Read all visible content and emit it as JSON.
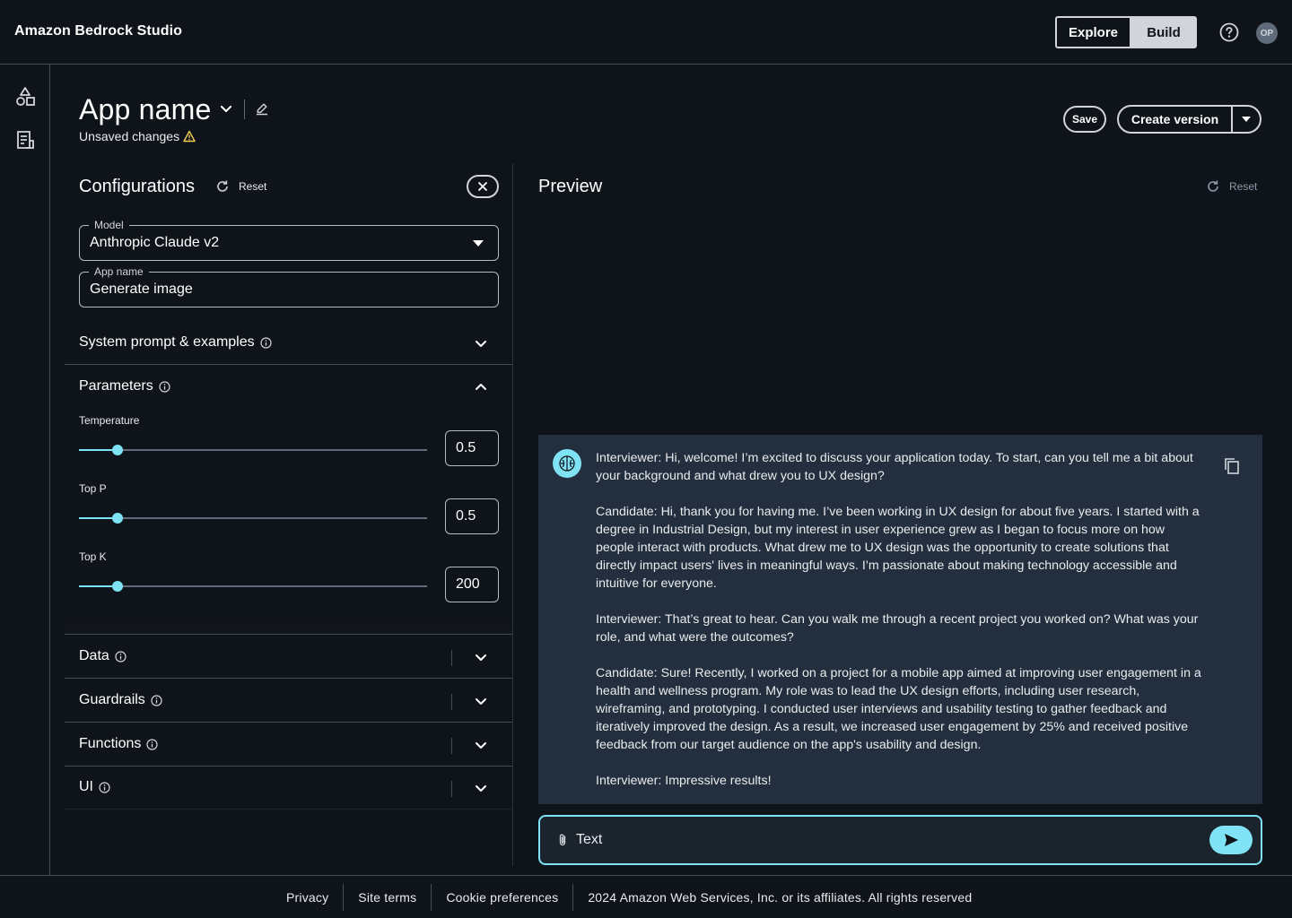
{
  "header": {
    "brand": "Amazon Bedrock Studio",
    "explore_label": "Explore",
    "build_label": "Build",
    "avatar_initials": "OP"
  },
  "app": {
    "name": "App name",
    "status": "Unsaved changes",
    "save_label": "Save",
    "create_version_label": "Create version"
  },
  "config": {
    "title": "Configurations",
    "reset_label": "Reset",
    "model": {
      "label": "Model",
      "value": "Anthropic Claude v2"
    },
    "app_name_field": {
      "label": "App name",
      "value": "Generate image"
    },
    "sections": {
      "system_prompt": "System prompt & examples",
      "parameters": "Parameters",
      "data": "Data",
      "guardrails": "Guardrails",
      "functions": "Functions",
      "ui": "UI"
    },
    "parameters": [
      {
        "label": "Temperature",
        "value": "0.5",
        "fraction": 0.11
      },
      {
        "label": "Top P",
        "value": "0.5",
        "fraction": 0.11
      },
      {
        "label": "Top K",
        "value": "200",
        "fraction": 0.11
      }
    ]
  },
  "preview": {
    "title": "Preview",
    "reset_label": "Reset",
    "messages": [
      "Interviewer: Hi, welcome! I’m excited to discuss your application today. To start, can you tell me a bit about your background and what drew you to UX design?",
      "Candidate: Hi, thank you for having me. I’ve been working in UX design for about five years. I started with a degree in Industrial Design, but my interest in user experience grew as I began to focus more on how people interact with products. What drew me to UX design was the opportunity to create solutions that directly impact users' lives in meaningful ways. I’m passionate about making technology accessible and intuitive for everyone.",
      "Interviewer: That’s great to hear. Can you walk me through a recent project you worked on? What was your role, and what were the outcomes?",
      "Candidate: Sure! Recently, I worked on a project for a mobile app aimed at improving user engagement in a health and wellness program. My role was to lead the UX design efforts, including user research, wireframing, and prototyping. I conducted user interviews and usability testing to gather feedback and iteratively improved the design. As a result, we increased user engagement by 25% and received positive feedback from our target audience on the app's usability and design.",
      "Interviewer: Impressive results!"
    ],
    "input_placeholder": "Text"
  },
  "footer": {
    "privacy": "Privacy",
    "site_terms": "Site terms",
    "cookie_preferences": "Cookie preferences",
    "copyright": "2024 Amazon Web Services, Inc. or its affiliates. All rights reserved"
  },
  "colors": {
    "background": "#0f141a",
    "accent": "#7fe3f5",
    "chat_bg": "#232f3e",
    "border": "#414d5c"
  },
  "icons": [
    "help-icon",
    "shapes-icon",
    "document-list-icon",
    "chevron-down-icon",
    "edit-icon",
    "warning-icon",
    "refresh-icon",
    "close-icon",
    "info-icon",
    "chevron-up-icon",
    "copy-icon",
    "paperclip-icon",
    "send-icon",
    "bot-brain-icon"
  ]
}
